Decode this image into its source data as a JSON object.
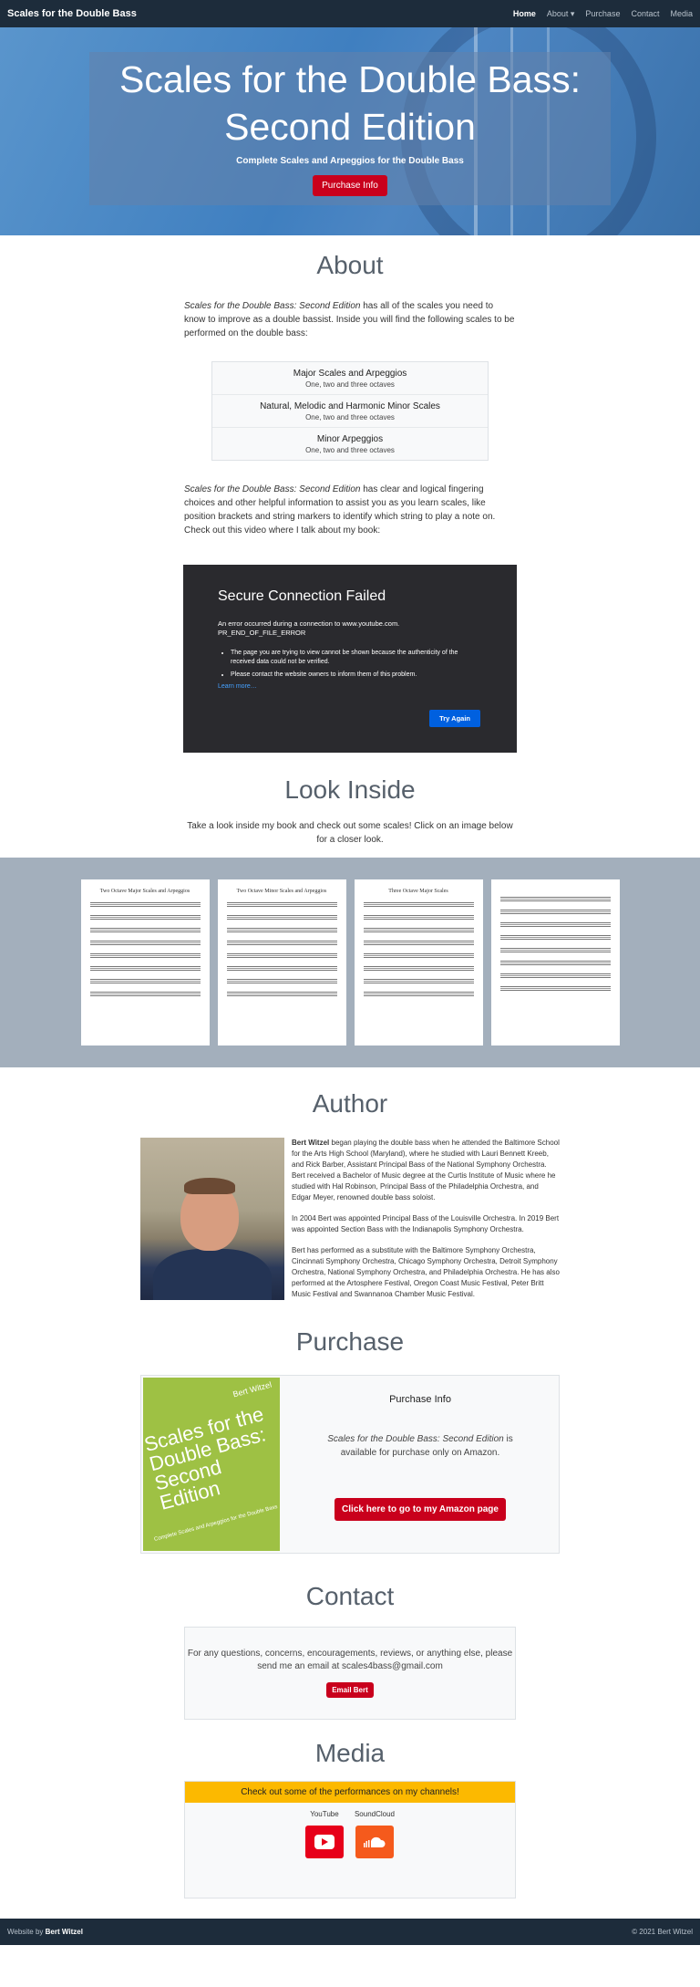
{
  "nav": {
    "brand": "Scales for the Double Bass",
    "items": [
      "Home",
      "About",
      "Purchase",
      "Contact",
      "Media"
    ],
    "about_caret": "▾"
  },
  "hero": {
    "title": "Scales for the Double Bass: Second Edition",
    "subtitle": "Complete Scales and Arpeggios for the Double Bass",
    "button": "Purchase Info"
  },
  "about": {
    "heading": "About",
    "intro_em": "Scales for the Double Bass: Second Edition",
    "intro_rest": " has all of the scales you need to know to improve as a double bassist. Inside you will find the following scales to be performed on the double bass:",
    "scales": [
      {
        "title": "Major Scales and Arpeggios",
        "sub": "One, two and three octaves"
      },
      {
        "title": "Natural, Melodic and Harmonic Minor Scales",
        "sub": "One, two and three octaves"
      },
      {
        "title": "Minor Arpeggios",
        "sub": "One, two and three octaves"
      }
    ],
    "p2_em": "Scales for the Double Bass: Second Edition",
    "p2_rest": " has clear and logical fingering choices and other helpful information to assist you as you learn scales, like position brackets and string markers to identify which string to play a note on. Check out this video where I talk about my book:"
  },
  "video": {
    "title": "Secure Connection Failed",
    "message_line1": "An error occurred during a connection to www.youtube.com.",
    "message_line2": "PR_END_OF_FILE_ERROR",
    "bullets": [
      "The page you are trying to view cannot be shown because the authenticity of the received data could not be verified.",
      "Please contact the website owners to inform them of this problem."
    ],
    "learn_more": "Learn more…",
    "try_again": "Try Again"
  },
  "look": {
    "heading": "Look Inside",
    "text": "Take a look inside my book and check out some scales! Click on an image below for a closer look.",
    "pages": [
      "Two Octave Major Scales and Arpeggios",
      "Two Octave Minor Scales and Arpeggios",
      "Three Octave Major Scales",
      ""
    ]
  },
  "author": {
    "heading": "Author",
    "name": "Bert Witzel",
    "p1_rest": " began playing the double bass when he attended the Baltimore School for the Arts High School (Maryland), where he studied with Lauri Bennett Kreeb, and Rick Barber, Assistant Principal Bass of the National Symphony Orchestra. Bert received a Bachelor of Music degree at the Curtis Institute of Music where he studied with Hal Robinson, Principal Bass of the Philadelphia Orchestra, and Edgar Meyer, renowned double bass soloist.",
    "p2": "In 2004 Bert was appointed Principal Bass of the Louisville Orchestra. In 2019 Bert was appointed Section Bass with the Indianapolis Symphony Orchestra.",
    "p3": "Bert has performed as a substitute with the Baltimore Symphony Orchestra, Cincinnati Symphony Orchestra, Chicago Symphony Orchestra, Detroit Symphony Orchestra, National Symphony Orchestra, and Philadelphia Orchestra. He has also performed at the Artosphere Festival, Oregon Coast Music Festival, Peter Britt Music Festival and Swannanoa Chamber Music Festival."
  },
  "purchase": {
    "heading": "Purchase",
    "cover_author": "Bert Witzel",
    "cover_title": "Scales for the Double Bass: Second Edition",
    "cover_sub": "Complete Scales and Arpeggios for the Double Bass",
    "info_title": "Purchase Info",
    "info_em": "Scales for the Double Bass: Second Edition",
    "info_rest": " is available for purchase only on Amazon.",
    "button": "Click here to go to my Amazon page"
  },
  "contact": {
    "heading": "Contact",
    "text": "For any questions, concerns, encouragements, reviews, or anything else, please send me an email at scales4bass@gmail.com",
    "button": "Email Bert"
  },
  "media": {
    "heading": "Media",
    "banner": "Check out some of the performances on my channels!",
    "youtube": "YouTube",
    "soundcloud": "SoundCloud"
  },
  "footer": {
    "prefix": "Website by ",
    "name": "Bert Witzel",
    "copyright": "© 2021 Bert Witzel"
  },
  "colors": {
    "accent_red": "#c9001c",
    "navbar": "#1d2c3b",
    "banner_yellow": "#fcb900"
  }
}
